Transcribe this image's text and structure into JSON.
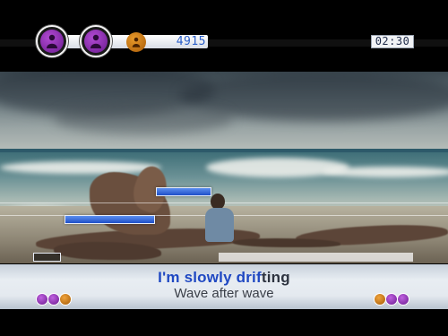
{
  "hud": {
    "score": "4915",
    "timer": "02:30",
    "players": [
      {
        "name": "player-1",
        "color": "#8a2bb0"
      },
      {
        "name": "player-2",
        "color": "#8a2bb0"
      },
      {
        "name": "player-3",
        "color": "#c87412"
      }
    ]
  },
  "lyrics": {
    "current_sung": "I'm slowly drif",
    "current_unsung": "ting",
    "next_line": "Wave after wave"
  },
  "colors": {
    "accent_blue": "#1f48c2",
    "purple_token": "#8a2bb0",
    "orange_token": "#c87412"
  },
  "icons": {
    "player_token_icon": "person-silhouette-icon",
    "timer_icon": "clock-icon"
  }
}
